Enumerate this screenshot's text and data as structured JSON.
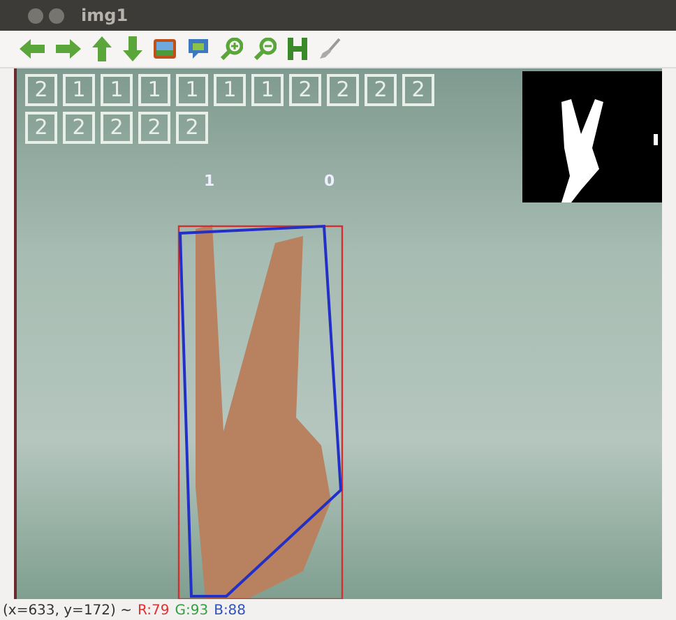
{
  "window": {
    "title": "img1"
  },
  "toolbar": [
    {
      "kind": "left"
    },
    {
      "kind": "right"
    },
    {
      "kind": "up"
    },
    {
      "kind": "down"
    },
    {
      "kind": "image"
    },
    {
      "kind": "panel"
    },
    {
      "kind": "zoom-in"
    },
    {
      "kind": "zoom-out"
    },
    {
      "kind": "save"
    },
    {
      "kind": "brush"
    }
  ],
  "overlay": {
    "digit_rows": [
      [
        "2",
        "1",
        "1",
        "1",
        "1",
        "1",
        "1",
        "2",
        "2",
        "2",
        "2"
      ],
      [
        "2",
        "2",
        "2",
        "2",
        "2"
      ]
    ],
    "markers": [
      {
        "label": "1"
      },
      {
        "label": "0"
      }
    ]
  },
  "status_bar": [
    {
      "text": "(x=633, y=172) ~"
    },
    {
      "text": "R:79",
      "color": "#e03030"
    },
    {
      "text": "G:93",
      "color": "#30a040"
    },
    {
      "text": "B:88",
      "color": "#3050c0"
    }
  ]
}
